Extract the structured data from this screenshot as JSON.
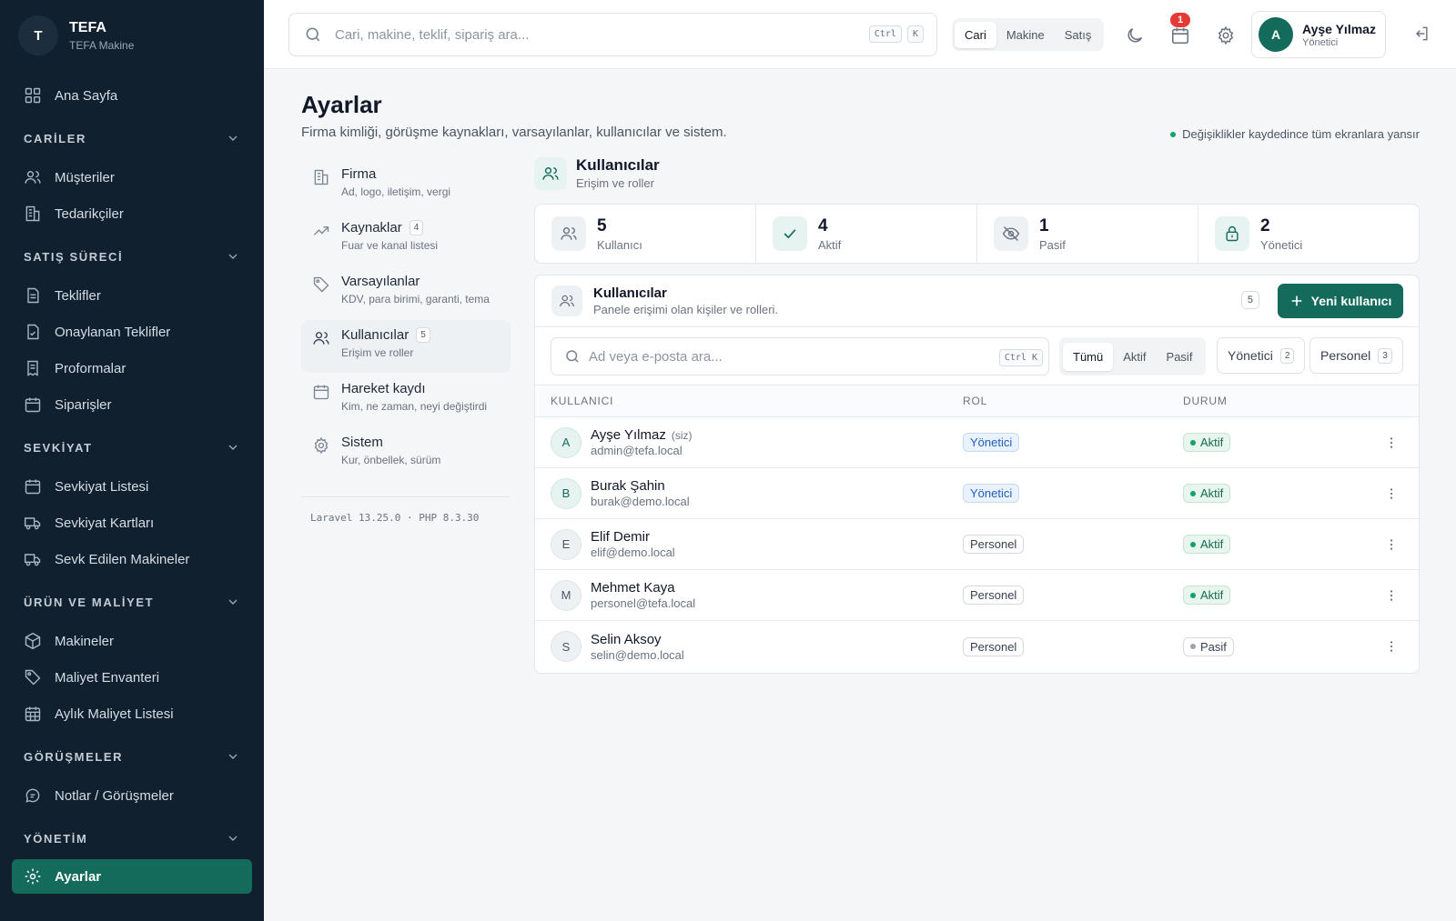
{
  "colors": {
    "sidebar_bg": "#10202f",
    "accent": "#146b5b",
    "active_green": "#10a36b",
    "badge_red": "#e53935"
  },
  "brand": {
    "logo_letter": "T",
    "name": "TEFA",
    "subtitle": "TEFA Makine"
  },
  "sidebar": {
    "home": {
      "label": "Ana Sayfa",
      "icon": "dashboard-icon"
    },
    "sections": [
      {
        "title": "CARİLER",
        "items": [
          {
            "label": "Müşteriler",
            "icon": "users-icon"
          },
          {
            "label": "Tedarikçiler",
            "icon": "building-icon"
          }
        ]
      },
      {
        "title": "SATIŞ SÜRECİ",
        "items": [
          {
            "label": "Teklifler",
            "icon": "file-icon"
          },
          {
            "label": "Onaylanan Teklifler",
            "icon": "file-check-icon"
          },
          {
            "label": "Proformalar",
            "icon": "receipt-icon"
          },
          {
            "label": "Siparişler",
            "icon": "calendar-icon"
          }
        ]
      },
      {
        "title": "SEVKİYAT",
        "items": [
          {
            "label": "Sevkiyat Listesi",
            "icon": "calendar-icon"
          },
          {
            "label": "Sevkiyat Kartları",
            "icon": "truck-icon"
          },
          {
            "label": "Sevk Edilen Makineler",
            "icon": "truck-icon"
          }
        ]
      },
      {
        "title": "ÜRÜN VE MALİYET",
        "items": [
          {
            "label": "Makineler",
            "icon": "box-icon"
          },
          {
            "label": "Maliyet Envanteri",
            "icon": "tag-icon"
          },
          {
            "label": "Aylık Maliyet Listesi",
            "icon": "calendar-grid-icon"
          }
        ]
      },
      {
        "title": "GÖRÜŞMELER",
        "items": [
          {
            "label": "Notlar / Görüşmeler",
            "icon": "chat-icon"
          }
        ]
      },
      {
        "title": "YÖNETİM",
        "items": []
      }
    ],
    "active": {
      "label": "Ayarlar",
      "icon": "gear-icon"
    }
  },
  "topbar": {
    "search_placeholder": "Cari, makine, teklif, sipariş ara...",
    "kbd_ctrl": "Ctrl",
    "kbd_k": "K",
    "scopes": [
      "Cari",
      "Makine",
      "Satış"
    ],
    "notification_count": "1",
    "user": {
      "initial": "A",
      "name": "Ayşe Yılmaz",
      "role": "Yönetici"
    }
  },
  "page": {
    "title": "Ayarlar",
    "description": "Firma kimliği, görüşme kaynakları, varsayılanlar, kullanıcılar ve sistem.",
    "save_note": "Değişiklikler kaydedince tüm ekranlara yansır"
  },
  "settings_nav": [
    {
      "title": "Firma",
      "desc": "Ad, logo, iletişim, vergi",
      "count": "",
      "icon": "building-icon"
    },
    {
      "title": "Kaynaklar",
      "desc": "Fuar ve kanal listesi",
      "count": "4",
      "icon": "trend-icon"
    },
    {
      "title": "Varsayılanlar",
      "desc": "KDV, para birimi, garanti, tema",
      "count": "",
      "icon": "tag-icon"
    },
    {
      "title": "Kullanıcılar",
      "desc": "Erişim ve roller",
      "count": "5",
      "icon": "users-icon"
    },
    {
      "title": "Hareket kaydı",
      "desc": "Kim, ne zaman, neyi değiştirdi",
      "count": "",
      "icon": "calendar-icon"
    },
    {
      "title": "Sistem",
      "desc": "Kur, önbellek, sürüm",
      "count": "",
      "icon": "gear-icon"
    }
  ],
  "version": "Laravel 13.25.0 · PHP 8.3.30",
  "section": {
    "title": "Kullanıcılar",
    "desc": "Erişim ve roller"
  },
  "stats": [
    {
      "value": "5",
      "label": "Kullanıcı",
      "icon": "users-icon"
    },
    {
      "value": "4",
      "label": "Aktif",
      "icon": "check-icon"
    },
    {
      "value": "1",
      "label": "Pasif",
      "icon": "eye-off-icon"
    },
    {
      "value": "2",
      "label": "Yönetici",
      "icon": "lock-icon"
    }
  ],
  "users_card": {
    "title": "Kullanıcılar",
    "desc": "Panele erişimi olan kişiler ve rolleri.",
    "count": "5",
    "new_button": "Yeni kullanıcı",
    "search_placeholder": "Ad veya e-posta ara...",
    "kbd": "Ctrl K",
    "status_filters": [
      "Tümü",
      "Aktif",
      "Pasif"
    ],
    "role_filters": [
      {
        "label": "Yönetici",
        "count": "2"
      },
      {
        "label": "Personel",
        "count": "3"
      }
    ],
    "columns": [
      "KULLANICI",
      "ROL",
      "DURUM"
    ],
    "rows": [
      {
        "initial": "A",
        "name": "Ayşe Yılmaz",
        "me": "(siz)",
        "email": "admin@tefa.local",
        "role": "Yönetici",
        "status": "Aktif"
      },
      {
        "initial": "B",
        "name": "Burak Şahin",
        "me": "",
        "email": "burak@demo.local",
        "role": "Yönetici",
        "status": "Aktif"
      },
      {
        "initial": "E",
        "name": "Elif Demir",
        "me": "",
        "email": "elif@demo.local",
        "role": "Personel",
        "status": "Aktif"
      },
      {
        "initial": "M",
        "name": "Mehmet Kaya",
        "me": "",
        "email": "personel@tefa.local",
        "role": "Personel",
        "status": "Aktif"
      },
      {
        "initial": "S",
        "name": "Selin Aksoy",
        "me": "",
        "email": "selin@demo.local",
        "role": "Personel",
        "status": "Pasif"
      }
    ]
  }
}
